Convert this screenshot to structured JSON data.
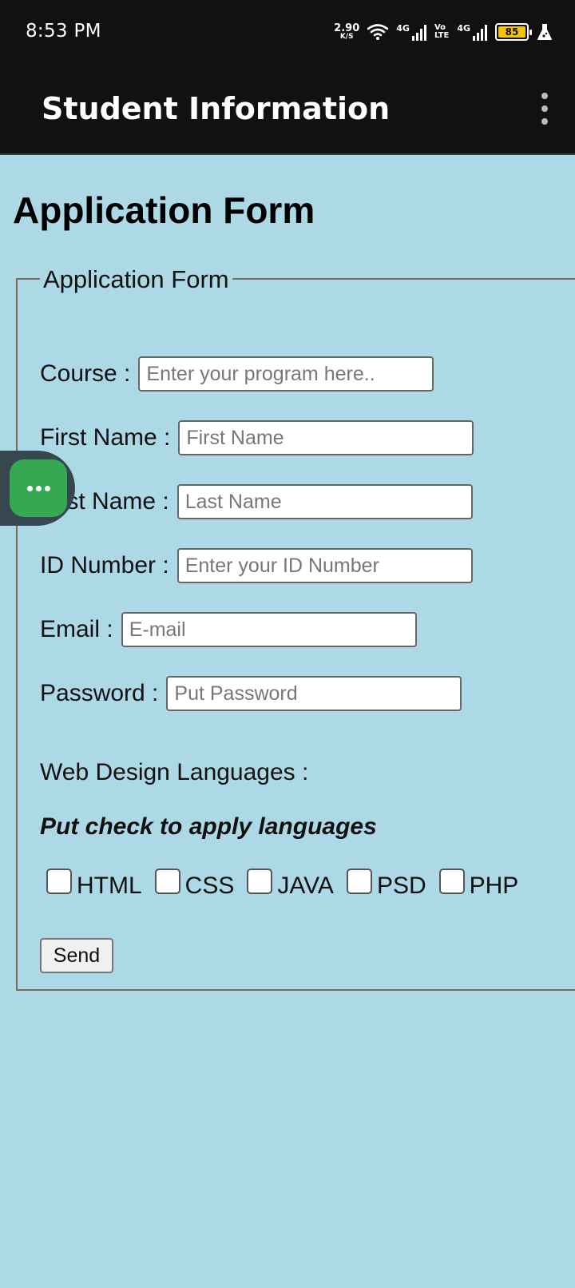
{
  "status_bar": {
    "time": "8:53 PM",
    "net_speed": "2.90",
    "net_unit": "K/S",
    "network1": "4G",
    "volte_top": "Vo",
    "volte_bottom": "LTE",
    "network2": "4G",
    "battery_level": "85",
    "icons": [
      "wifi-icon",
      "signal-icon",
      "battery-icon",
      "flask-icon"
    ],
    "battery_color": "#f4c20d"
  },
  "app_bar": {
    "title": "Student Information",
    "menu_icon": "more-vert-icon"
  },
  "page": {
    "title": "Application Form"
  },
  "form": {
    "legend": "Application Form",
    "fields": {
      "course": {
        "label": "Course :",
        "placeholder": "Enter your program here.."
      },
      "first_name": {
        "label": "First Name :",
        "placeholder": "First Name"
      },
      "last_name": {
        "label": "Last Name :",
        "placeholder": "Last Name"
      },
      "id_number": {
        "label": "ID Number :",
        "placeholder": "Enter your ID Number"
      },
      "email": {
        "label": "Email :",
        "placeholder": "E-mail"
      },
      "password": {
        "label": "Password :",
        "placeholder": "Put Password"
      }
    },
    "languages_label": "Web Design Languages :",
    "languages_hint": "Put check to apply languages",
    "languages": [
      {
        "label": "HTML",
        "checked": false
      },
      {
        "label": "CSS",
        "checked": false
      },
      {
        "label": "JAVA",
        "checked": false
      },
      {
        "label": "PSD",
        "checked": false
      },
      {
        "label": "PHP",
        "checked": false
      }
    ],
    "send_label": "Send"
  },
  "floating_button": {
    "icon": "more-horiz-icon",
    "color": "#34a853"
  },
  "colors": {
    "background": "#add8e6",
    "bar": "#111111"
  }
}
